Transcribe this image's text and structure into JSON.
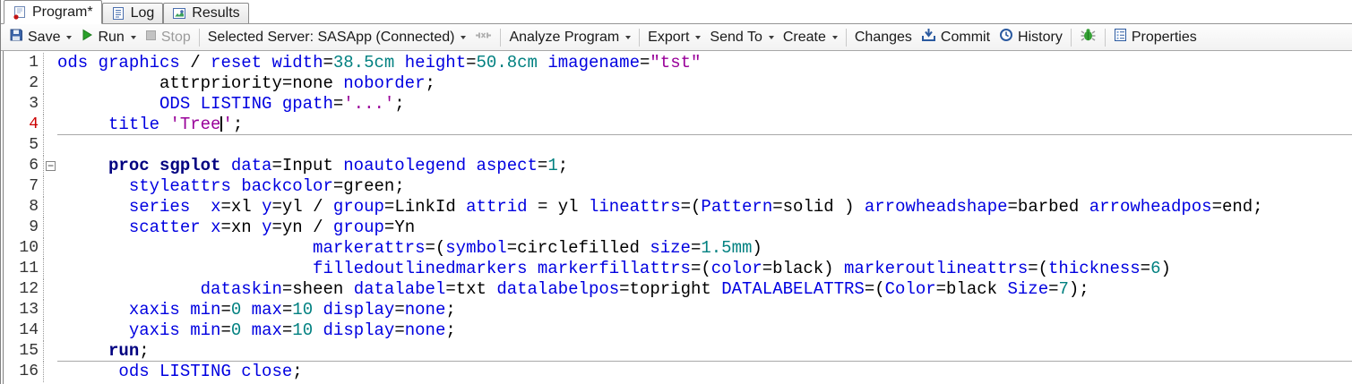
{
  "tabs": [
    {
      "label": "Program*"
    },
    {
      "label": "Log"
    },
    {
      "label": "Results"
    }
  ],
  "toolbar": {
    "save": "Save",
    "run": "Run",
    "stop": "Stop",
    "server": "Selected Server: SASApp (Connected)",
    "analyze": "Analyze Program",
    "export": "Export",
    "send_to": "Send To",
    "create": "Create",
    "changes": "Changes",
    "commit": "Commit",
    "history": "History",
    "properties": "Properties"
  },
  "colors": {
    "keyword": "#0000E0",
    "proc": "#000080",
    "number": "#008080",
    "string": "#990099",
    "plain": "#000000",
    "line_number": "#333333",
    "current_line_number": "#CC0000",
    "divider": "#A8A8A8"
  },
  "editor": {
    "fold_symbol": "−",
    "lines": [
      {
        "num": "1",
        "indent": 0,
        "tokens": [
          [
            "k",
            "ods graphics"
          ],
          [
            "p",
            " / "
          ],
          [
            "k",
            "reset width"
          ],
          [
            "p",
            "="
          ],
          [
            "n",
            "38.5cm"
          ],
          [
            "p",
            " "
          ],
          [
            "k",
            "height"
          ],
          [
            "p",
            "="
          ],
          [
            "n",
            "50.8cm"
          ],
          [
            "p",
            " "
          ],
          [
            "k",
            "imagename"
          ],
          [
            "p",
            "="
          ],
          [
            "s",
            "\"tst\""
          ]
        ]
      },
      {
        "num": "2",
        "indent": 10,
        "tokens": [
          [
            "p",
            "attrpriority=none "
          ],
          [
            "k",
            "noborder"
          ],
          [
            "p",
            ";"
          ]
        ]
      },
      {
        "num": "3",
        "indent": 10,
        "tokens": [
          [
            "k",
            "ODS LISTING gpath"
          ],
          [
            "p",
            "="
          ],
          [
            "s",
            "'...'"
          ],
          [
            "p",
            ";"
          ]
        ]
      },
      {
        "num": "4",
        "indent": 5,
        "current": true,
        "divider": true,
        "tokens": [
          [
            "k",
            "title"
          ],
          [
            "p",
            " "
          ],
          [
            "s",
            "'Tree"
          ],
          [
            "caret",
            ""
          ],
          [
            "s",
            "'"
          ],
          [
            "p",
            ";"
          ]
        ]
      },
      {
        "num": "5",
        "indent": 0,
        "tokens": []
      },
      {
        "num": "6",
        "indent": 5,
        "fold": true,
        "tokens": [
          [
            "b",
            "proc sgplot"
          ],
          [
            "p",
            " "
          ],
          [
            "k",
            "data"
          ],
          [
            "p",
            "=Input "
          ],
          [
            "k",
            "noautolegend aspect"
          ],
          [
            "p",
            "="
          ],
          [
            "n",
            "1"
          ],
          [
            "p",
            ";"
          ]
        ]
      },
      {
        "num": "7",
        "indent": 7,
        "tokens": [
          [
            "k",
            "styleattrs backcolor"
          ],
          [
            "p",
            "=green;"
          ]
        ]
      },
      {
        "num": "8",
        "indent": 7,
        "tokens": [
          [
            "k",
            "series"
          ],
          [
            "p",
            "  "
          ],
          [
            "k",
            "x"
          ],
          [
            "p",
            "=xl "
          ],
          [
            "k",
            "y"
          ],
          [
            "p",
            "=yl / "
          ],
          [
            "k",
            "group"
          ],
          [
            "p",
            "=LinkId "
          ],
          [
            "k",
            "attrid"
          ],
          [
            "p",
            " = yl "
          ],
          [
            "k",
            "lineattrs"
          ],
          [
            "p",
            "=("
          ],
          [
            "k",
            "Pattern"
          ],
          [
            "p",
            "=solid ) "
          ],
          [
            "k",
            "arrowheadshape"
          ],
          [
            "p",
            "=barbed "
          ],
          [
            "k",
            "arrowheadpos"
          ],
          [
            "p",
            "=end;"
          ]
        ]
      },
      {
        "num": "9",
        "indent": 7,
        "tokens": [
          [
            "k",
            "scatter"
          ],
          [
            "p",
            " "
          ],
          [
            "k",
            "x"
          ],
          [
            "p",
            "=xn "
          ],
          [
            "k",
            "y"
          ],
          [
            "p",
            "=yn / "
          ],
          [
            "k",
            "group"
          ],
          [
            "p",
            "=Yn"
          ]
        ]
      },
      {
        "num": "10",
        "indent": 25,
        "tokens": [
          [
            "k",
            "markerattrs"
          ],
          [
            "p",
            "=("
          ],
          [
            "k",
            "symbol"
          ],
          [
            "p",
            "=circlefilled "
          ],
          [
            "k",
            "size"
          ],
          [
            "p",
            "="
          ],
          [
            "n",
            "1.5mm"
          ],
          [
            "p",
            ")"
          ]
        ]
      },
      {
        "num": "11",
        "indent": 25,
        "tokens": [
          [
            "k",
            "filledoutlinedmarkers"
          ],
          [
            "p",
            " "
          ],
          [
            "k",
            "markerfillattrs"
          ],
          [
            "p",
            "=("
          ],
          [
            "k",
            "color"
          ],
          [
            "p",
            "=black) "
          ],
          [
            "k",
            "markeroutlineattrs"
          ],
          [
            "p",
            "=("
          ],
          [
            "k",
            "thickness"
          ],
          [
            "p",
            "="
          ],
          [
            "n",
            "6"
          ],
          [
            "p",
            ")"
          ]
        ]
      },
      {
        "num": "12",
        "indent": 14,
        "tokens": [
          [
            "k",
            "dataskin"
          ],
          [
            "p",
            "=sheen "
          ],
          [
            "k",
            "datalabel"
          ],
          [
            "p",
            "=txt "
          ],
          [
            "k",
            "datalabelpos"
          ],
          [
            "p",
            "=topright "
          ],
          [
            "k",
            "DATALABELATTRS"
          ],
          [
            "p",
            "=("
          ],
          [
            "k",
            "Color"
          ],
          [
            "p",
            "=black "
          ],
          [
            "k",
            "Size"
          ],
          [
            "p",
            "="
          ],
          [
            "n",
            "7"
          ],
          [
            "p",
            ");"
          ]
        ]
      },
      {
        "num": "13",
        "indent": 7,
        "tokens": [
          [
            "k",
            "xaxis min"
          ],
          [
            "p",
            "="
          ],
          [
            "n",
            "0"
          ],
          [
            "p",
            " "
          ],
          [
            "k",
            "max"
          ],
          [
            "p",
            "="
          ],
          [
            "n",
            "10"
          ],
          [
            "p",
            " "
          ],
          [
            "k",
            "display"
          ],
          [
            "p",
            "="
          ],
          [
            "k",
            "none"
          ],
          [
            "p",
            ";"
          ]
        ]
      },
      {
        "num": "14",
        "indent": 7,
        "tokens": [
          [
            "k",
            "yaxis min"
          ],
          [
            "p",
            "="
          ],
          [
            "n",
            "0"
          ],
          [
            "p",
            " "
          ],
          [
            "k",
            "max"
          ],
          [
            "p",
            "="
          ],
          [
            "n",
            "10"
          ],
          [
            "p",
            " "
          ],
          [
            "k",
            "display"
          ],
          [
            "p",
            "="
          ],
          [
            "k",
            "none"
          ],
          [
            "p",
            ";"
          ]
        ]
      },
      {
        "num": "15",
        "indent": 5,
        "divider": true,
        "tokens": [
          [
            "b",
            "run"
          ],
          [
            "p",
            ";"
          ]
        ]
      },
      {
        "num": "16",
        "indent": 6,
        "tokens": [
          [
            "k",
            "ods LISTING close"
          ],
          [
            "p",
            ";"
          ]
        ]
      }
    ]
  }
}
